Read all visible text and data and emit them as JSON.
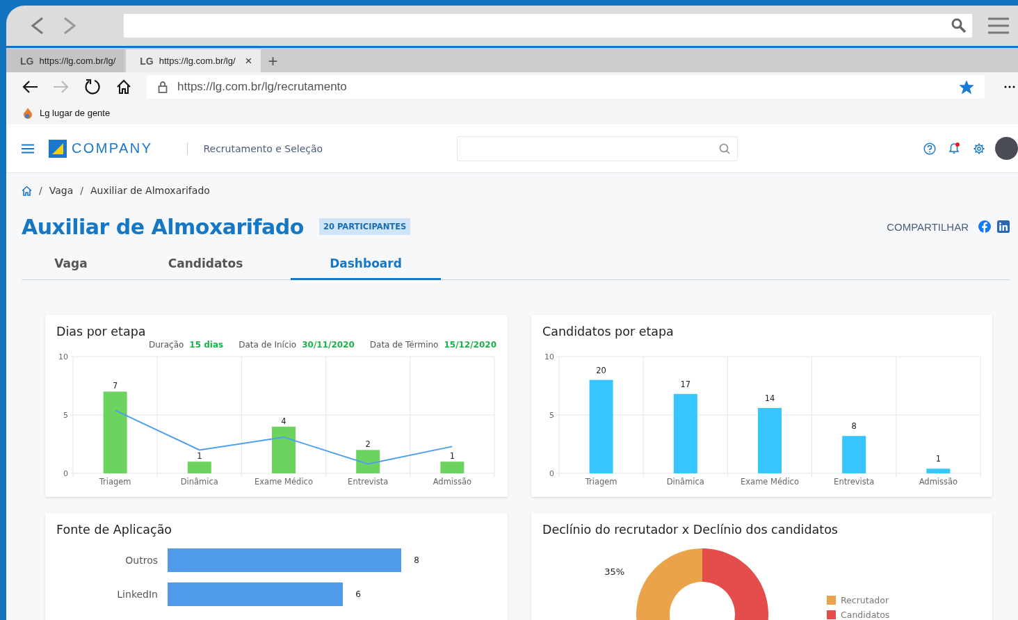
{
  "browser_tabs": [
    {
      "favicon": "LG",
      "url": "https://lg.com.br/lg/",
      "selected": false
    },
    {
      "favicon": "LG",
      "url": "https://lg.com.br/lg/",
      "selected": true,
      "close": "×"
    }
  ],
  "new_tab": "+",
  "navigation": {
    "forward_enabled": false
  },
  "address_bar": {
    "url": "https://lg.com.br/lg/recrutamento",
    "starred": true
  },
  "bookmarks": [
    {
      "label": "Lg lugar de gente"
    }
  ],
  "app_header": {
    "brand": "COMPANY",
    "module": "Recrutamento e Seleção",
    "has_notification": true
  },
  "breadcrumb": [
    {
      "separator": "/",
      "label": "Vaga"
    },
    {
      "separator": "/",
      "label": "Auxiliar de Almoxarifado"
    }
  ],
  "job": {
    "title": "Auxiliar de Almoxarifado",
    "badge": "20 PARTICIPANTES",
    "share_label": "COMPARTILHAR"
  },
  "page_tabs": [
    {
      "label": "Vaga",
      "selected": false
    },
    {
      "label": "Candidatos",
      "selected": false
    },
    {
      "label": "Dashboard",
      "selected": true
    }
  ],
  "cards": [
    {
      "title": "Dias por etapa",
      "stats": [
        {
          "label": "Duração",
          "value": "15 dias"
        },
        {
          "label": "Data de Início",
          "value": "30/11/2020"
        },
        {
          "label": "Data de Término",
          "value": "15/12/2020"
        }
      ],
      "chart_data": {
        "type": "bar",
        "categories": [
          "Triagem",
          "Dinâmica",
          "Exame Médico",
          "Entrevista",
          "Admissão"
        ],
        "ylim": [
          0,
          10
        ],
        "yticks": [
          0,
          5,
          10
        ],
        "series": [
          {
            "type": "bar",
            "color": "#6dd35f",
            "values": [
              7,
              1,
              4,
              2,
              1
            ],
            "value_labels": [
              "7",
              "1",
              "4",
              "2",
              "1"
            ]
          },
          {
            "type": "line",
            "color": "#4e9ef0",
            "values": [
              5.4,
              2,
              3.1,
              0.8,
              2.3
            ]
          }
        ]
      }
    },
    {
      "title": "Candidatos por etapa",
      "axis_labels": [
        "10",
        "5",
        "0"
      ],
      "chart_data": {
        "type": "bar",
        "categories": [
          "Triagem",
          "Dinâmica",
          "Exame Médico",
          "Entrevista",
          "Admissão"
        ],
        "data_labels": true,
        "series": [
          {
            "type": "bar",
            "color": "#36c6fd",
            "values": [
              20,
              17,
              14,
              8,
              1
            ]
          }
        ]
      }
    },
    {
      "title": "Fonte de Aplicação",
      "chart_data": {
        "type": "bar",
        "orientation": "horizontal",
        "categories": [
          "Outros",
          "LinkedIn"
        ],
        "data_labels": true,
        "series": [
          {
            "color": "#509be9",
            "values": [
              8,
              6
            ]
          }
        ]
      }
    },
    {
      "title": "Declínio do recrutador x Declínio dos candidatos",
      "legend": [
        {
          "color": "#eba34b"
        },
        {
          "color": "#e54c4c"
        }
      ],
      "chart_data": {
        "type": "donut",
        "categories": [
          "Recrutador",
          "Candidatos"
        ],
        "value_labels": [
          "35%",
          null
        ],
        "series": [
          {
            "values": [
              35,
              65
            ]
          }
        ]
      }
    }
  ]
}
